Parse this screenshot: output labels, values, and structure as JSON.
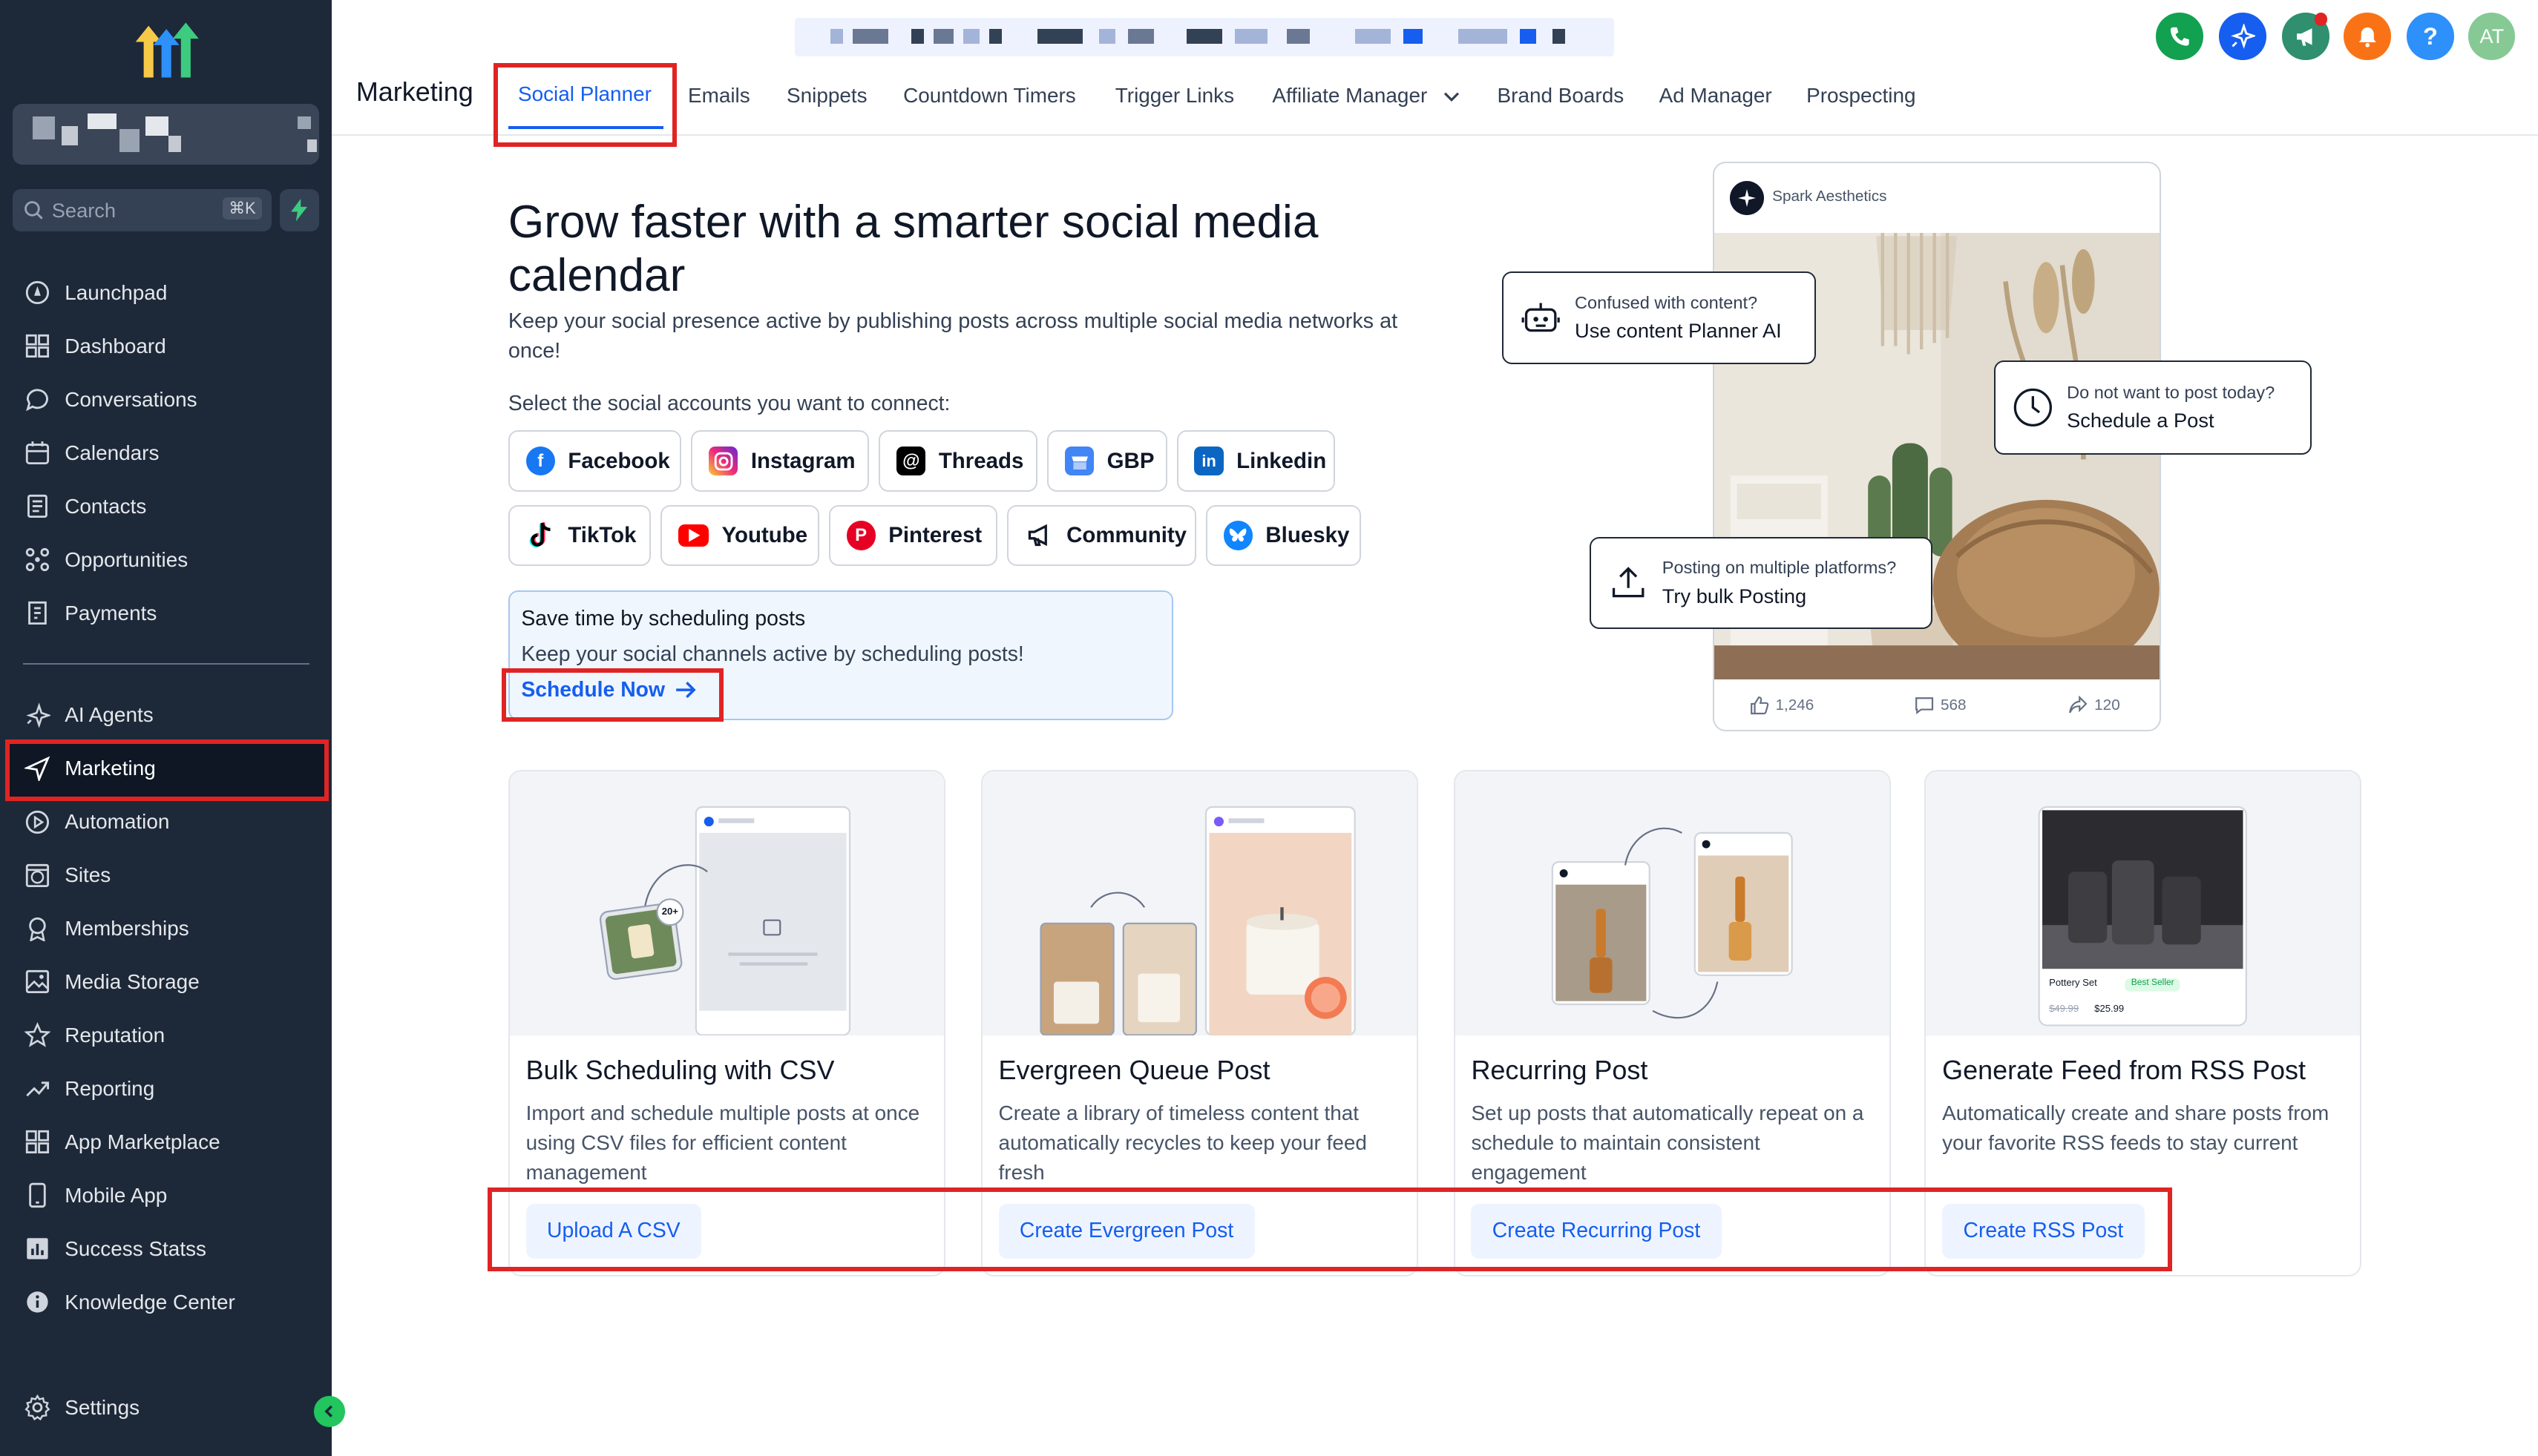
{
  "sidebar": {
    "search_placeholder": "Search",
    "search_shortcut": "⌘K",
    "items": [
      {
        "label": "Launchpad",
        "icon": "rocket-icon"
      },
      {
        "label": "Dashboard",
        "icon": "grid-icon"
      },
      {
        "label": "Conversations",
        "icon": "chat-icon"
      },
      {
        "label": "Calendars",
        "icon": "calendar-icon"
      },
      {
        "label": "Contacts",
        "icon": "contacts-icon"
      },
      {
        "label": "Opportunities",
        "icon": "pipeline-icon"
      },
      {
        "label": "Payments",
        "icon": "receipt-icon"
      },
      {
        "label": "AI Agents",
        "icon": "sparkle-icon"
      },
      {
        "label": "Marketing",
        "icon": "send-icon"
      },
      {
        "label": "Automation",
        "icon": "play-circle-icon"
      },
      {
        "label": "Sites",
        "icon": "globe-window-icon"
      },
      {
        "label": "Memberships",
        "icon": "award-icon"
      },
      {
        "label": "Media Storage",
        "icon": "image-icon"
      },
      {
        "label": "Reputation",
        "icon": "star-icon"
      },
      {
        "label": "Reporting",
        "icon": "trend-icon"
      },
      {
        "label": "App Marketplace",
        "icon": "apps-icon"
      },
      {
        "label": "Mobile App",
        "icon": "phone-icon"
      },
      {
        "label": "Success Statss",
        "icon": "bar-chart-icon"
      },
      {
        "label": "Knowledge Center",
        "icon": "info-icon"
      }
    ],
    "settings_label": "Settings",
    "active_item": "Marketing"
  },
  "header": {
    "section_title": "Marketing",
    "tabs": [
      {
        "label": "Social Planner",
        "active": true
      },
      {
        "label": "Emails"
      },
      {
        "label": "Snippets"
      },
      {
        "label": "Countdown Timers"
      },
      {
        "label": "Trigger Links"
      },
      {
        "label": "Affiliate Manager"
      },
      {
        "label": "Brand Boards"
      },
      {
        "label": "Ad Manager"
      },
      {
        "label": "Prospecting"
      }
    ],
    "avatar_initials": "AT",
    "help_label": "?",
    "colors": {
      "phone": "#12a150",
      "ai": "#155eef",
      "megaphone": "#2f8f6f",
      "bell": "#f97316",
      "help": "#2e90fa",
      "avatar": "#86c995"
    }
  },
  "hero": {
    "title": "Grow faster with a smarter social media calendar",
    "subtitle": "Keep your social presence active by publishing posts across multiple social media networks at once!",
    "select_label": "Select the social accounts you want to connect:",
    "accounts": [
      {
        "label": "Facebook",
        "color": "#1877f2"
      },
      {
        "label": "Instagram",
        "color": "#e1306c"
      },
      {
        "label": "Threads",
        "color": "#000000"
      },
      {
        "label": "GBP",
        "color": "#4285f4"
      },
      {
        "label": "Linkedin",
        "color": "#0a66c2"
      },
      {
        "label": "TikTok",
        "color": "#000000"
      },
      {
        "label": "Youtube",
        "color": "#ff0000"
      },
      {
        "label": "Pinterest",
        "color": "#e60023"
      },
      {
        "label": "Community",
        "color": "#101828"
      },
      {
        "label": "Bluesky",
        "color": "#1185fe"
      }
    ],
    "schedule_box": {
      "title": "Save time by scheduling posts",
      "subtitle": "Keep your social channels active by scheduling posts!",
      "cta": "Schedule Now"
    }
  },
  "preview": {
    "brand": "Spark Aesthetics",
    "likes": "1,246",
    "comments": "568",
    "shares": "120",
    "bubbles": [
      {
        "small": "Confused with content?",
        "main": "Use content Planner AI"
      },
      {
        "small": "Do not want to post today?",
        "main": "Schedule a Post"
      },
      {
        "small": "Posting on multiple platforms?",
        "main": "Try bulk Posting"
      }
    ]
  },
  "cards": [
    {
      "title": "Bulk Scheduling with CSV",
      "desc": "Import and schedule multiple posts at once using CSV files for efficient content management",
      "cta": "Upload A CSV",
      "badge": "20+"
    },
    {
      "title": "Evergreen Queue Post",
      "desc": "Create a library of timeless content that automatically recycles to keep your feed fresh",
      "cta": "Create Evergreen Post"
    },
    {
      "title": "Recurring Post",
      "desc": "Set up posts that automatically repeat on a schedule to maintain consistent engagement",
      "cta": "Create Recurring Post"
    },
    {
      "title": "Generate Feed from RSS Post",
      "desc": "Automatically create and share posts from your favorite RSS feeds to stay current",
      "cta": "Create RSS Post",
      "product_name": "Pottery Set",
      "product_badge": "Best Seller",
      "old_price": "$49.99",
      "new_price": "$25.99"
    }
  ]
}
